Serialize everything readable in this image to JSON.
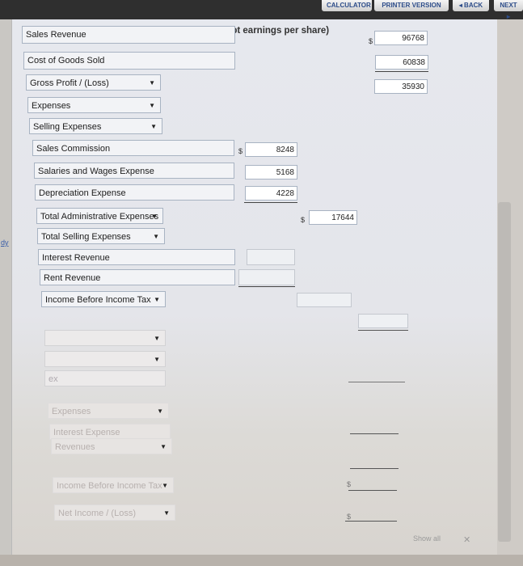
{
  "toolbar": {
    "calculator_label": "CALCULATOR",
    "printer_label": "PRINTER VERSION",
    "back_label": "◂ BACK",
    "next_label": "NEXT ▸"
  },
  "statement": {
    "heading": "(In thousands, except earnings per share)",
    "currency": "$",
    "rows": {
      "sales_revenue": "Sales Revenue",
      "sales_revenue_value": "96768",
      "cogs": "Cost of Goods Sold",
      "cogs_value": "60838",
      "gross_profit": "Gross Profit / (Loss)",
      "gross_profit_value": "35930",
      "expenses": "Expenses",
      "selling_expenses": "Selling Expenses",
      "sales_commission": "Sales Commission",
      "sales_commission_value": "8248",
      "salaries": "Salaries and Wages Expense",
      "salaries_value": "5168",
      "depreciation": "Depreciation Expense",
      "depreciation_value": "4228",
      "total_admin": "Total Administrative Expenses",
      "total_admin_value": "17644",
      "total_selling": "Total Selling Expenses",
      "interest_revenue": "Interest Revenue",
      "rent_revenue": "Rent Revenue",
      "income_before_tax": "Income Before Income Tax",
      "faded_expenses": "Expenses",
      "faded_interest_expense": "Interest Expense",
      "faded_revenues": "Revenues",
      "faded_income_before_tax": "Income Before Income Tax",
      "faded_net_income": "Net Income / (Loss)"
    },
    "side_note": "dy",
    "faded_ex": "ex",
    "show_all": "Show all"
  }
}
